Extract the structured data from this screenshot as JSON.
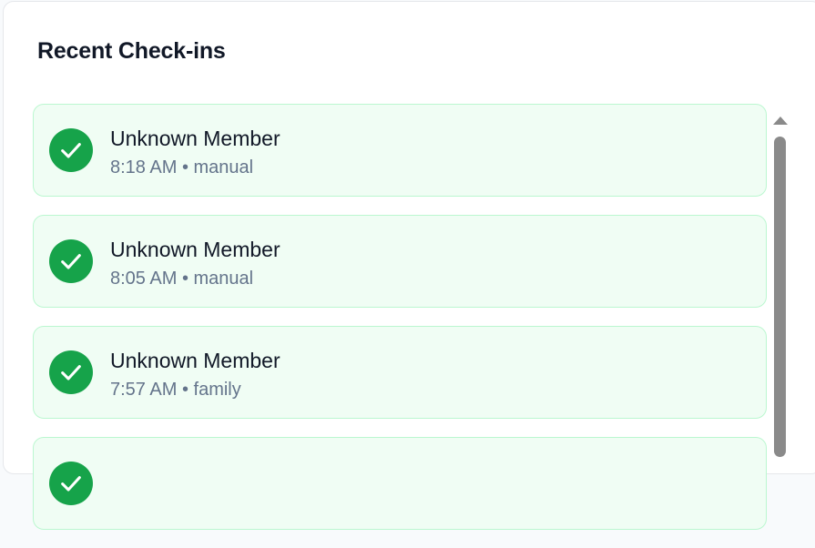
{
  "panel": {
    "title": "Recent Check-ins"
  },
  "checkins": [
    {
      "name": "Unknown Member",
      "time": "8:18 AM",
      "method": "manual",
      "icon": "check-circle-icon"
    },
    {
      "name": "Unknown Member",
      "time": "8:05 AM",
      "method": "manual",
      "icon": "check-circle-icon"
    },
    {
      "name": "Unknown Member",
      "time": "7:57 AM",
      "method": "family",
      "icon": "check-circle-icon"
    },
    {
      "name": "",
      "time": "",
      "method": "",
      "icon": "check-circle-icon"
    }
  ],
  "separator": " • ",
  "colors": {
    "success": "#16a34a",
    "item_bg": "#f0fdf4",
    "item_border": "#bbf7d0",
    "meta_text": "#64748b"
  }
}
